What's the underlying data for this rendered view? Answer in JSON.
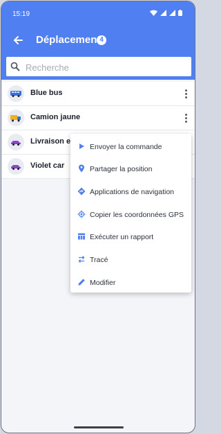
{
  "status_bar": {
    "time": "15:19"
  },
  "app_bar": {
    "title": "Déplacement",
    "count": "4"
  },
  "search": {
    "placeholder": "Recherche",
    "value": ""
  },
  "vehicles": [
    {
      "name": "Blue bus",
      "icon": "bus-icon"
    },
    {
      "name": "Camion jaune",
      "icon": "truck-icon"
    },
    {
      "name": "Livraison ex",
      "icon": "car-icon"
    },
    {
      "name": "Violet car",
      "icon": "car-icon"
    }
  ],
  "context_menu": {
    "items": [
      {
        "label": "Envoyer la commande",
        "icon": "play-icon"
      },
      {
        "label": "Partager la position",
        "icon": "location-pin-icon"
      },
      {
        "label": "Applications de navigation",
        "icon": "directions-icon"
      },
      {
        "label": "Copier les coordonnées GPS",
        "icon": "gps-icon"
      },
      {
        "label": "Exécuter un rapport",
        "icon": "table-icon"
      },
      {
        "label": "Tracé",
        "icon": "route-icon"
      },
      {
        "label": "Modifier",
        "icon": "edit-icon"
      }
    ]
  },
  "colors": {
    "primary": "#4f7ff0",
    "background": "#f3f5f9",
    "icon_accent": "#4f7ff0"
  }
}
